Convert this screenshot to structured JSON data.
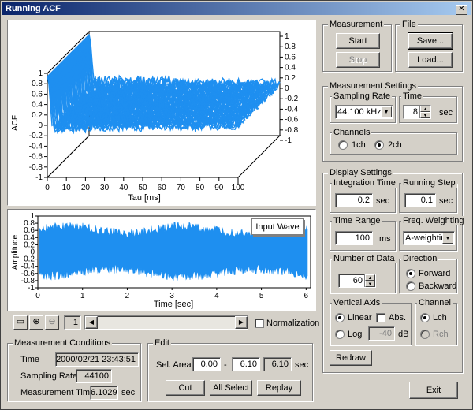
{
  "window": {
    "title": "Running ACF",
    "close_icon": "✕"
  },
  "acf_plot": {
    "ylabel": "ACF",
    "xlabel": "Tau [ms]",
    "x_ticks": [
      "0",
      "10",
      "20",
      "30",
      "40",
      "50",
      "60",
      "70",
      "80",
      "90",
      "100"
    ],
    "left_y_ticks": [
      "1",
      "0.8",
      "0.6",
      "0.4",
      "0.2",
      "0",
      "-0.2",
      "-0.4",
      "-0.6",
      "-0.8",
      "-1"
    ],
    "right_y_ticks": [
      "1",
      "0.8",
      "0.6",
      "0.4",
      "0.2",
      "0",
      "-0.2",
      "-0.4",
      "-0.6",
      "-0.8",
      "-1"
    ]
  },
  "wave_plot": {
    "ylabel": "Amplitude",
    "xlabel": "Time [sec]",
    "x_ticks": [
      "0",
      "1",
      "2",
      "3",
      "4",
      "5",
      "6"
    ],
    "y_ticks": [
      "1",
      "0.8",
      "0.6",
      "0.4",
      "0.2",
      "0",
      "-0.2",
      "-0.4",
      "-0.6",
      "-0.8",
      "-1"
    ],
    "overlay_button": "Input Wave",
    "color": "#1e8ff0"
  },
  "toolbar": {
    "page_value": "1",
    "normalization_label": "Normalization"
  },
  "measurement": {
    "title": "Measurement",
    "start": "Start",
    "stop": "Stop"
  },
  "file": {
    "title": "File",
    "save": "Save...",
    "load": "Load..."
  },
  "measurement_settings": {
    "title": "Measurement Settings",
    "sampling_rate_title": "Sampling Rate",
    "sampling_rate_value": "44.100 kHz",
    "time_title": "Time",
    "time_value": "8",
    "time_unit": "sec",
    "channels_title": "Channels",
    "ch1": "1ch",
    "ch2": "2ch"
  },
  "display_settings": {
    "title": "Display Settings",
    "integration_time_title": "Integration Time",
    "integration_time_value": "0.2",
    "integration_time_unit": "sec",
    "running_step_title": "Running Step",
    "running_step_value": "0.1",
    "running_step_unit": "sec",
    "time_range_title": "Time Range",
    "time_range_value": "100",
    "time_range_unit": "ms",
    "freq_weighting_title": "Freq. Weighting",
    "freq_weighting_value": "A-weighting",
    "number_of_data_title": "Number of Data",
    "number_of_data_value": "60",
    "direction_title": "Direction",
    "forward": "Forward",
    "backward": "Backward",
    "vertical_axis_title": "Vertical Axis",
    "linear": "Linear",
    "abs": "Abs.",
    "log": "Log",
    "log_value": "-40",
    "log_unit": "dB",
    "channel_title": "Channel",
    "lch": "Lch",
    "rch": "Rch",
    "redraw": "Redraw"
  },
  "conditions": {
    "title": "Measurement Conditions",
    "time_label": "Time",
    "time_value": "2000/02/21 23:43:51",
    "sampling_rate_label": "Sampling Rate",
    "sampling_rate_value": "44100",
    "measurement_time_label": "Measurement Time",
    "measurement_time_value": "6.1029",
    "measurement_time_unit": "sec"
  },
  "edit": {
    "title": "Edit",
    "sel_area_label": "Sel. Area",
    "start_value": "0.00",
    "dash": "-",
    "end_value": "6.10",
    "length_value": "6.10",
    "unit": "sec",
    "cut": "Cut",
    "all_select": "All Select",
    "replay": "Replay"
  },
  "exit": "Exit"
}
